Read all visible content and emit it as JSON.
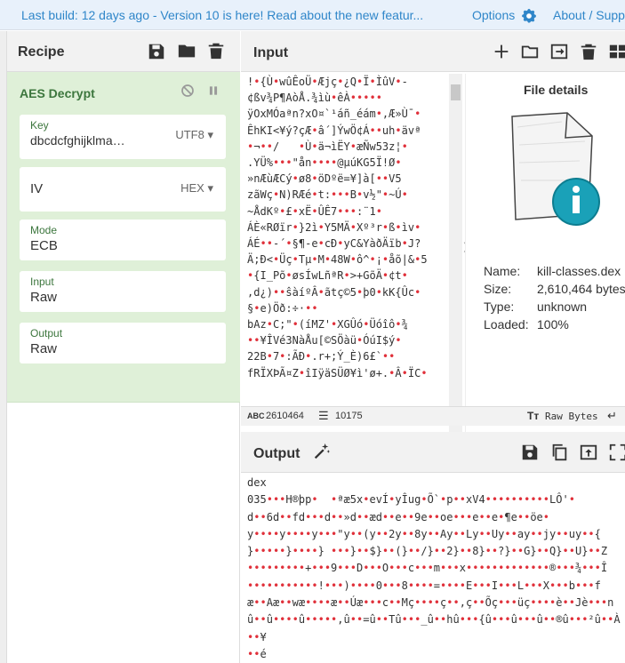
{
  "banner": {
    "note": "Last build: 12 days ago - Version 10 is here! Read about the new featur...",
    "options": "Options",
    "about": "About / Supp"
  },
  "recipe": {
    "title": "Recipe",
    "operation": {
      "name": "AES Decrypt",
      "key_label": "Key",
      "key_value": "dbcdcfghijklma…",
      "key_format": "UTF8",
      "iv_label": "IV",
      "iv_format": "HEX",
      "mode_label": "Mode",
      "mode_value": "ECB",
      "input_label": "Input",
      "input_value": "Raw",
      "output_label": "Output",
      "output_value": "Raw"
    }
  },
  "input": {
    "title": "Input",
    "lines": [
      "!•{Ù•wûÊoÜ•Æjç•¿Q•Ï•ÌûV•-",
      "¢ßv¾P¶AòÅ.¾ìù•êÀ•••••",
      "ÿOxMÓaªn?xO¤`¹áñ_éám•,Æ»Ù¯•",
      "ÊhKI<¥ý?çÆ•â´]ÝwÖ¢Á••uh•ävª",
      "•¬••/   •Ù•ä¬ìËY•æÑw53z¦•",
      ".YÜ%•••\"ån••••@µúKG5Ï!Ø•",
      "»nÆùÆCý•ø8•öDºë=¥]à[••V5",
      "zãWç•N)RÆé•t:•••B•v½\"•~Ú•",
      "~ÅdKº•£•xË•ÛÊ7•••:¨1•",
      "ÁÈ«RØïr•}2ì•Y5MÄ•Xº³r•ß•ìv•",
      "ÁÉ••-´•§¶-e•cÐ•yC&YàðÄïb•J?",
      "Ä;Ð<•Üç•Tµ•M•48W•ô^•¡•åõ|&•5",
      "•{I_Põ•øsÍwLñªR•>+GõÄ•¢t•",
      ",d¿)••ŝàíºÂ•ãtç©5•þ0•kK{Ûc•",
      "§•e)Öð:÷·••",
      "bAz•C;\"•(íMZ'•XGÛó•Üóîô•¾",
      "••¥ÎVé3NàÅu[©SÖàü•ÓúI$ý•",
      "22B•7•:ÃÐ•.r+;Ý_È)6£`••",
      "fRÏXÞÃ¤Z•îIÿäSÜØ¥ì'ø+.•Â•ÏC•"
    ],
    "file_details": {
      "title": "File details",
      "name_label": "Name:",
      "name_value": "kill-classes.dex",
      "size_label": "Size:",
      "size_value": "2,610,464 bytes",
      "type_label": "Type:",
      "type_value": "unknown",
      "loaded_label": "Loaded:",
      "loaded_value": "100%"
    },
    "status": {
      "length": "2610464",
      "lines": "10175",
      "mode": "Raw Bytes"
    }
  },
  "output": {
    "title": "Output",
    "lines": [
      "dex",
      "035•••H®þp•  •ªæ5x•evÍ•yÎug•Õ`•p••xV4••••••••••LÔ'•",
      "d••6d••fd•••d••»d••æd••e••9e••oe•••e••e•¶e••öe•",
      "y••••y••••y•••\"y••(y••2y••8y••Ay••Ly••Uy••ay••jy••uy••{",
      "}•••••}••••} •••}••$}••(}••/}••2}••8}••?}••G}••Q}••U}••Z",
      "•••••••••+•••9•••D•••O•••c•••m•••x•••••••••••••®•••¾•••Î",
      "•••••••••••!•••)••••0•••8••••=••••E•••I•••L•••X•••b•••f",
      "æ••Aæ••wæ••••æ••Úæ•••c••Mç••••ç••,ç••Õç•••üç••••è••Jè•••n",
      "û••û••••û•••••,û••=û••Tû•••_û••hû•••{û•••û•••û••®û•••²û••À",
      "••¥",
      "••é"
    ]
  },
  "colors": {
    "accent": "#2f86c9",
    "op_bg": "#dff0d8",
    "op_text": "#3c763d",
    "icon_teal": "#1aa1b8"
  }
}
